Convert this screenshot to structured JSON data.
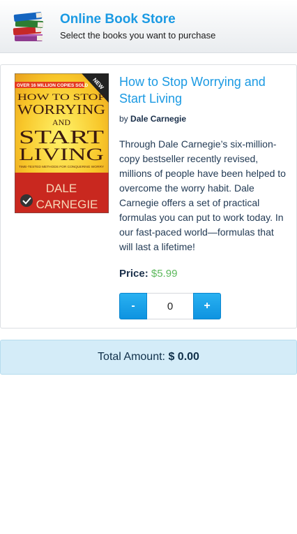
{
  "header": {
    "title": "Online Book Store",
    "subtitle": "Select the books you want to purchase",
    "logo_icon": "stack-of-books-icon"
  },
  "product": {
    "cover": {
      "badge": "NEW",
      "banner": "OVER 16 MILLION COPIES SOLD",
      "title_lines": [
        "HOW TO STOP",
        "WORRYING",
        "AND",
        "START",
        "LIVING"
      ],
      "tagline": "TIME-TESTED METHODS FOR CONQUERING WORRY",
      "author_lines": [
        "DALE",
        "CARNEGIE"
      ]
    },
    "title": "How to Stop Worrying and Start Living",
    "by_label": "by",
    "author": "Dale Carnegie",
    "description": "Through Dale Carnegie’s six-million-copy bestseller recently revised, millions of people have been helped to overcome the worry habit. Dale Carnegie offers a set of practical formulas you can put to work today. In our fast-paced world—formulas that will last a lifetime!",
    "price_label": "Price:",
    "price": "$5.99",
    "quantity": {
      "minus_label": "-",
      "plus_label": "+",
      "value": "0"
    }
  },
  "total": {
    "label": "Total Amount:",
    "value": "$ 0.00"
  },
  "colors": {
    "accent": "#1b9ae3",
    "price_green": "#5cb85c",
    "total_bg": "#d4ecf8"
  }
}
